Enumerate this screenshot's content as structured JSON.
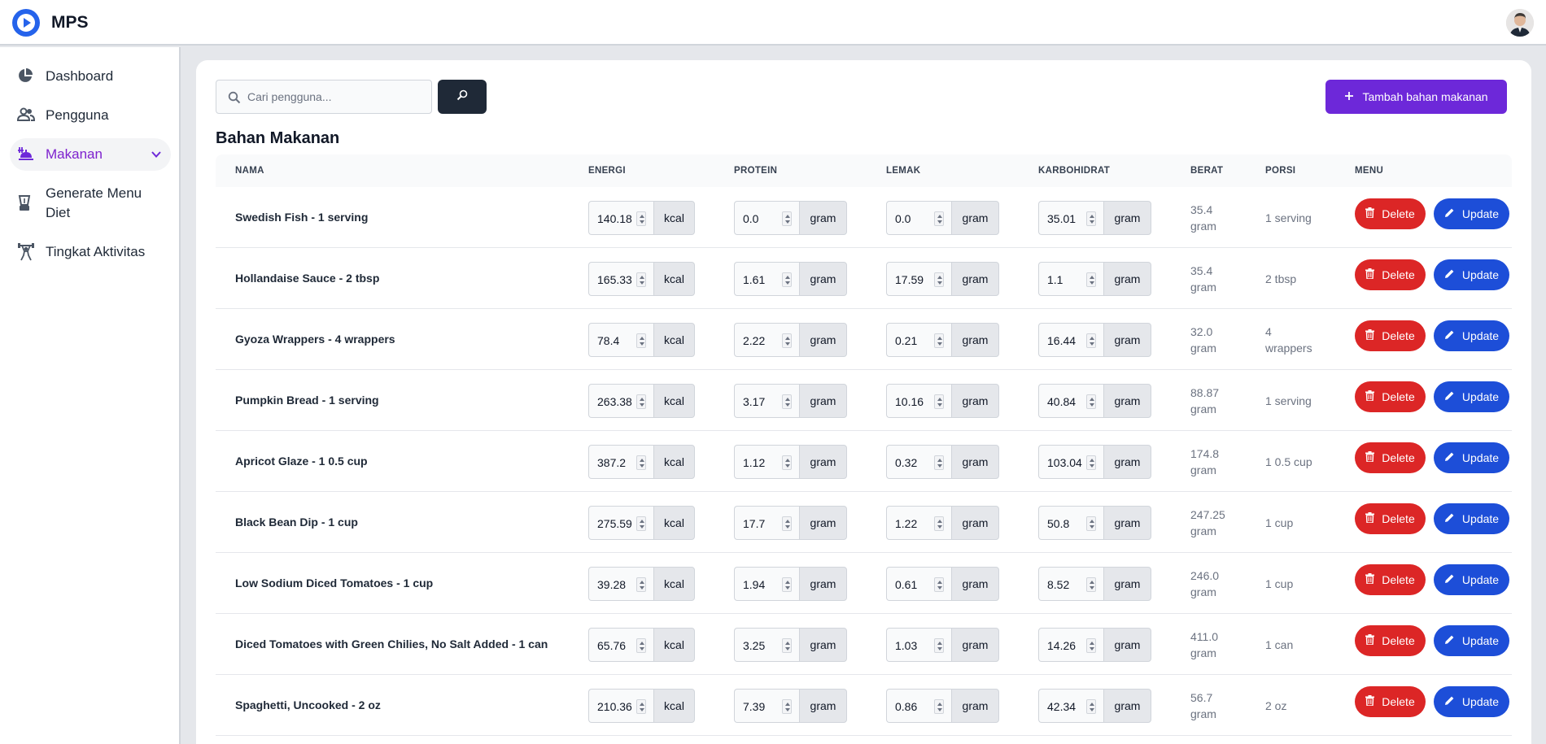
{
  "app": {
    "name": "MPS"
  },
  "sidebar": {
    "items": [
      {
        "label": "Dashboard",
        "icon": "pie-chart-icon"
      },
      {
        "label": "Pengguna",
        "icon": "users-icon"
      },
      {
        "label": "Makanan",
        "icon": "food-tray-icon",
        "active": true
      },
      {
        "label": "Generate Menu Diet",
        "icon": "blender-icon"
      },
      {
        "label": "Tingkat Aktivitas",
        "icon": "weightlifting-icon"
      }
    ]
  },
  "search": {
    "placeholder": "Cari pengguna...",
    "value": ""
  },
  "actions": {
    "add_label": "Tambah bahan makanan"
  },
  "page": {
    "title": "Bahan Makanan"
  },
  "table": {
    "headers": {
      "nama": "NAMA",
      "energi": "ENERGI",
      "protein": "PROTEIN",
      "lemak": "LEMAK",
      "karbohidrat": "KARBOHIDRAT",
      "berat": "BERAT",
      "porsi": "PORSI",
      "menu": "MENU"
    },
    "units": {
      "energy": "kcal",
      "mass": "gram"
    },
    "buttons": {
      "delete": "Delete",
      "update": "Update"
    },
    "rows": [
      {
        "name": "Swedish Fish - 1 serving",
        "energy": "140.18",
        "protein": "0.0",
        "fat": "0.0",
        "carbs": "35.01",
        "weight": "35.4 gram",
        "portion": "1 serving"
      },
      {
        "name": "Hollandaise Sauce - 2 tbsp",
        "energy": "165.33",
        "protein": "1.61",
        "fat": "17.59",
        "carbs": "1.1",
        "weight": "35.4 gram",
        "portion": "2 tbsp"
      },
      {
        "name": "Gyoza Wrappers - 4 wrappers",
        "energy": "78.4",
        "protein": "2.22",
        "fat": "0.21",
        "carbs": "16.44",
        "weight": "32.0 gram",
        "portion": "4 wrappers"
      },
      {
        "name": "Pumpkin Bread - 1 serving",
        "energy": "263.38",
        "protein": "3.17",
        "fat": "10.16",
        "carbs": "40.84",
        "weight": "88.87 gram",
        "portion": "1 serving"
      },
      {
        "name": "Apricot Glaze - 1 0.5 cup",
        "energy": "387.2",
        "protein": "1.12",
        "fat": "0.32",
        "carbs": "103.04",
        "weight": "174.8 gram",
        "portion": "1 0.5 cup"
      },
      {
        "name": "Black Bean Dip - 1 cup",
        "energy": "275.59",
        "protein": "17.7",
        "fat": "1.22",
        "carbs": "50.8",
        "weight": "247.25 gram",
        "portion": "1 cup"
      },
      {
        "name": "Low Sodium Diced Tomatoes - 1 cup",
        "energy": "39.28",
        "protein": "1.94",
        "fat": "0.61",
        "carbs": "8.52",
        "weight": "246.0 gram",
        "portion": "1 cup"
      },
      {
        "name": "Diced Tomatoes with Green Chilies, No Salt Added - 1 can",
        "energy": "65.76",
        "protein": "3.25",
        "fat": "1.03",
        "carbs": "14.26",
        "weight": "411.0 gram",
        "portion": "1 can"
      },
      {
        "name": "Spaghetti, Uncooked - 2 oz",
        "energy": "210.36",
        "protein": "7.39",
        "fat": "0.86",
        "carbs": "42.34",
        "weight": "56.7 gram",
        "portion": "2 oz"
      }
    ]
  },
  "colors": {
    "primary": "#6d28d9",
    "active_nav": "#7e22ce",
    "delete": "#dc2626",
    "update": "#1d4ed8",
    "logo": "#2563eb"
  }
}
